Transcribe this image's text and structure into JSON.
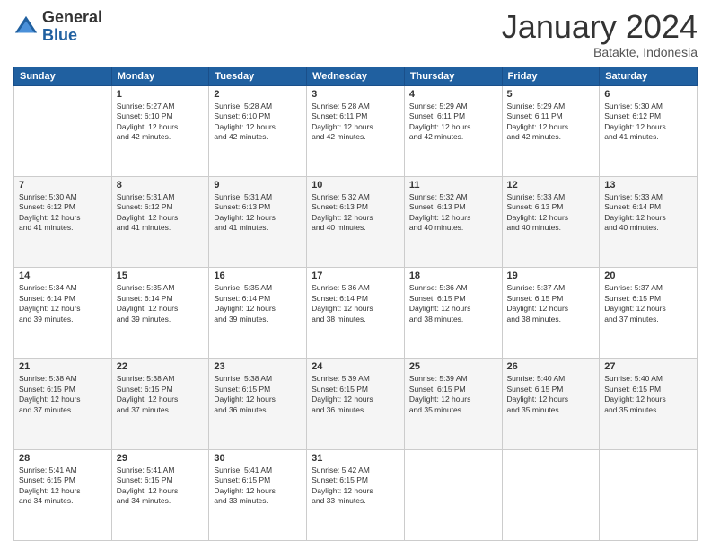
{
  "logo": {
    "general": "General",
    "blue": "Blue"
  },
  "header": {
    "title": "January 2024",
    "location": "Batakte, Indonesia"
  },
  "weekdays": [
    "Sunday",
    "Monday",
    "Tuesday",
    "Wednesday",
    "Thursday",
    "Friday",
    "Saturday"
  ],
  "weeks": [
    [
      {
        "day": "",
        "info": ""
      },
      {
        "day": "1",
        "info": "Sunrise: 5:27 AM\nSunset: 6:10 PM\nDaylight: 12 hours\nand 42 minutes."
      },
      {
        "day": "2",
        "info": "Sunrise: 5:28 AM\nSunset: 6:10 PM\nDaylight: 12 hours\nand 42 minutes."
      },
      {
        "day": "3",
        "info": "Sunrise: 5:28 AM\nSunset: 6:11 PM\nDaylight: 12 hours\nand 42 minutes."
      },
      {
        "day": "4",
        "info": "Sunrise: 5:29 AM\nSunset: 6:11 PM\nDaylight: 12 hours\nand 42 minutes."
      },
      {
        "day": "5",
        "info": "Sunrise: 5:29 AM\nSunset: 6:11 PM\nDaylight: 12 hours\nand 42 minutes."
      },
      {
        "day": "6",
        "info": "Sunrise: 5:30 AM\nSunset: 6:12 PM\nDaylight: 12 hours\nand 41 minutes."
      }
    ],
    [
      {
        "day": "7",
        "info": "Sunrise: 5:30 AM\nSunset: 6:12 PM\nDaylight: 12 hours\nand 41 minutes."
      },
      {
        "day": "8",
        "info": "Sunrise: 5:31 AM\nSunset: 6:12 PM\nDaylight: 12 hours\nand 41 minutes."
      },
      {
        "day": "9",
        "info": "Sunrise: 5:31 AM\nSunset: 6:13 PM\nDaylight: 12 hours\nand 41 minutes."
      },
      {
        "day": "10",
        "info": "Sunrise: 5:32 AM\nSunset: 6:13 PM\nDaylight: 12 hours\nand 40 minutes."
      },
      {
        "day": "11",
        "info": "Sunrise: 5:32 AM\nSunset: 6:13 PM\nDaylight: 12 hours\nand 40 minutes."
      },
      {
        "day": "12",
        "info": "Sunrise: 5:33 AM\nSunset: 6:13 PM\nDaylight: 12 hours\nand 40 minutes."
      },
      {
        "day": "13",
        "info": "Sunrise: 5:33 AM\nSunset: 6:14 PM\nDaylight: 12 hours\nand 40 minutes."
      }
    ],
    [
      {
        "day": "14",
        "info": "Sunrise: 5:34 AM\nSunset: 6:14 PM\nDaylight: 12 hours\nand 39 minutes."
      },
      {
        "day": "15",
        "info": "Sunrise: 5:35 AM\nSunset: 6:14 PM\nDaylight: 12 hours\nand 39 minutes."
      },
      {
        "day": "16",
        "info": "Sunrise: 5:35 AM\nSunset: 6:14 PM\nDaylight: 12 hours\nand 39 minutes."
      },
      {
        "day": "17",
        "info": "Sunrise: 5:36 AM\nSunset: 6:14 PM\nDaylight: 12 hours\nand 38 minutes."
      },
      {
        "day": "18",
        "info": "Sunrise: 5:36 AM\nSunset: 6:15 PM\nDaylight: 12 hours\nand 38 minutes."
      },
      {
        "day": "19",
        "info": "Sunrise: 5:37 AM\nSunset: 6:15 PM\nDaylight: 12 hours\nand 38 minutes."
      },
      {
        "day": "20",
        "info": "Sunrise: 5:37 AM\nSunset: 6:15 PM\nDaylight: 12 hours\nand 37 minutes."
      }
    ],
    [
      {
        "day": "21",
        "info": "Sunrise: 5:38 AM\nSunset: 6:15 PM\nDaylight: 12 hours\nand 37 minutes."
      },
      {
        "day": "22",
        "info": "Sunrise: 5:38 AM\nSunset: 6:15 PM\nDaylight: 12 hours\nand 37 minutes."
      },
      {
        "day": "23",
        "info": "Sunrise: 5:38 AM\nSunset: 6:15 PM\nDaylight: 12 hours\nand 36 minutes."
      },
      {
        "day": "24",
        "info": "Sunrise: 5:39 AM\nSunset: 6:15 PM\nDaylight: 12 hours\nand 36 minutes."
      },
      {
        "day": "25",
        "info": "Sunrise: 5:39 AM\nSunset: 6:15 PM\nDaylight: 12 hours\nand 35 minutes."
      },
      {
        "day": "26",
        "info": "Sunrise: 5:40 AM\nSunset: 6:15 PM\nDaylight: 12 hours\nand 35 minutes."
      },
      {
        "day": "27",
        "info": "Sunrise: 5:40 AM\nSunset: 6:15 PM\nDaylight: 12 hours\nand 35 minutes."
      }
    ],
    [
      {
        "day": "28",
        "info": "Sunrise: 5:41 AM\nSunset: 6:15 PM\nDaylight: 12 hours\nand 34 minutes."
      },
      {
        "day": "29",
        "info": "Sunrise: 5:41 AM\nSunset: 6:15 PM\nDaylight: 12 hours\nand 34 minutes."
      },
      {
        "day": "30",
        "info": "Sunrise: 5:41 AM\nSunset: 6:15 PM\nDaylight: 12 hours\nand 33 minutes."
      },
      {
        "day": "31",
        "info": "Sunrise: 5:42 AM\nSunset: 6:15 PM\nDaylight: 12 hours\nand 33 minutes."
      },
      {
        "day": "",
        "info": ""
      },
      {
        "day": "",
        "info": ""
      },
      {
        "day": "",
        "info": ""
      }
    ]
  ]
}
